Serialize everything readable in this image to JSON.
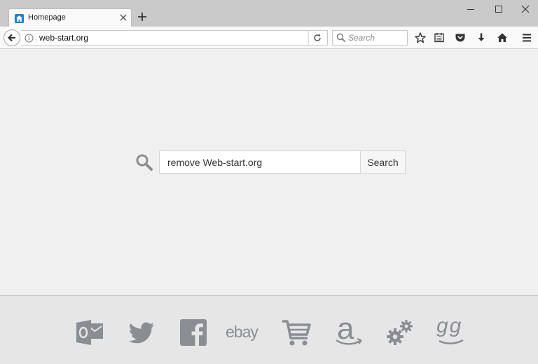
{
  "browser": {
    "tab_title": "Homepage",
    "url": "web-start.org",
    "search_placeholder": "Search"
  },
  "page": {
    "search_value": "remove Web-start.org",
    "search_button": "Search"
  },
  "quick_links": [
    {
      "name": "outlook",
      "icon": "outlook-icon"
    },
    {
      "name": "twitter",
      "icon": "twitter-icon"
    },
    {
      "name": "facebook",
      "icon": "facebook-icon"
    },
    {
      "name": "ebay",
      "icon": "ebay-icon",
      "text": "ebay"
    },
    {
      "name": "shopping",
      "icon": "cart-icon"
    },
    {
      "name": "amazon",
      "icon": "amazon-icon",
      "text": "a"
    },
    {
      "name": "settings",
      "icon": "gears-icon"
    },
    {
      "name": "gg",
      "icon": "gg-icon",
      "text": "gg"
    }
  ],
  "colors": {
    "icon_gray": "#8a8e93",
    "page_bg": "#f0f0f0",
    "footer_bg": "#e6e6e6",
    "favicon_blue": "#1f7fc1"
  }
}
